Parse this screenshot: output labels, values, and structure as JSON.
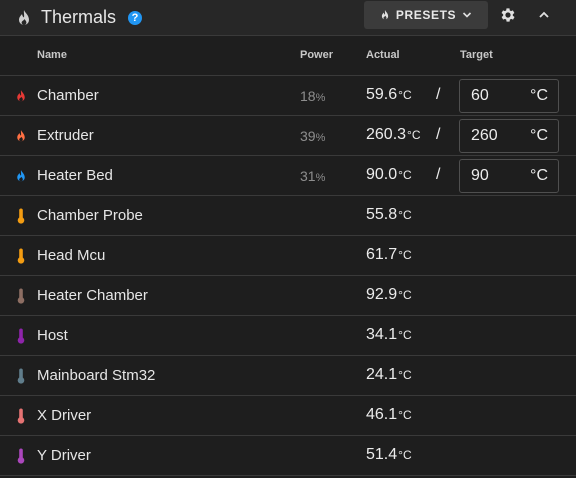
{
  "header": {
    "title": "Thermals",
    "help": "?",
    "presets_label": "PRESETS"
  },
  "columns": {
    "name": "Name",
    "power": "Power",
    "actual": "Actual",
    "target": "Target"
  },
  "heaters": [
    {
      "name": "Chamber",
      "power": "18",
      "power_unit": "%",
      "actual": "59.6",
      "unit": "°C",
      "target": "60",
      "target_unit": "°C",
      "color": "#e53935"
    },
    {
      "name": "Extruder",
      "power": "39",
      "power_unit": "%",
      "actual": "260.3",
      "unit": "°C",
      "target": "260",
      "target_unit": "°C",
      "color": "#ff7043"
    },
    {
      "name": "Heater Bed",
      "power": "31",
      "power_unit": "%",
      "actual": "90.0",
      "unit": "°C",
      "target": "90",
      "target_unit": "°C",
      "color": "#2196f3"
    }
  ],
  "sensors": [
    {
      "name": "Chamber Probe",
      "actual": "55.8",
      "unit": "°C",
      "color": "#f39c12"
    },
    {
      "name": "Head Mcu",
      "actual": "61.7",
      "unit": "°C",
      "color": "#f39c12"
    },
    {
      "name": "Heater Chamber",
      "actual": "92.9",
      "unit": "°C",
      "color": "#8d6e63"
    },
    {
      "name": "Host",
      "actual": "34.1",
      "unit": "°C",
      "color": "#8e24aa"
    },
    {
      "name": "Mainboard Stm32",
      "actual": "24.1",
      "unit": "°C",
      "color": "#607d8b"
    },
    {
      "name": "X Driver",
      "actual": "46.1",
      "unit": "°C",
      "color": "#e57373"
    },
    {
      "name": "Y Driver",
      "actual": "51.4",
      "unit": "°C",
      "color": "#ab47bc"
    }
  ],
  "icons": {
    "header": "fire-icon",
    "presets": "fire-icon",
    "heater": "fire-icon",
    "sensor": "thermometer-icon",
    "settings": "gear-icon",
    "collapse": "chevron-up-icon",
    "dropdown": "chevron-down-icon"
  }
}
